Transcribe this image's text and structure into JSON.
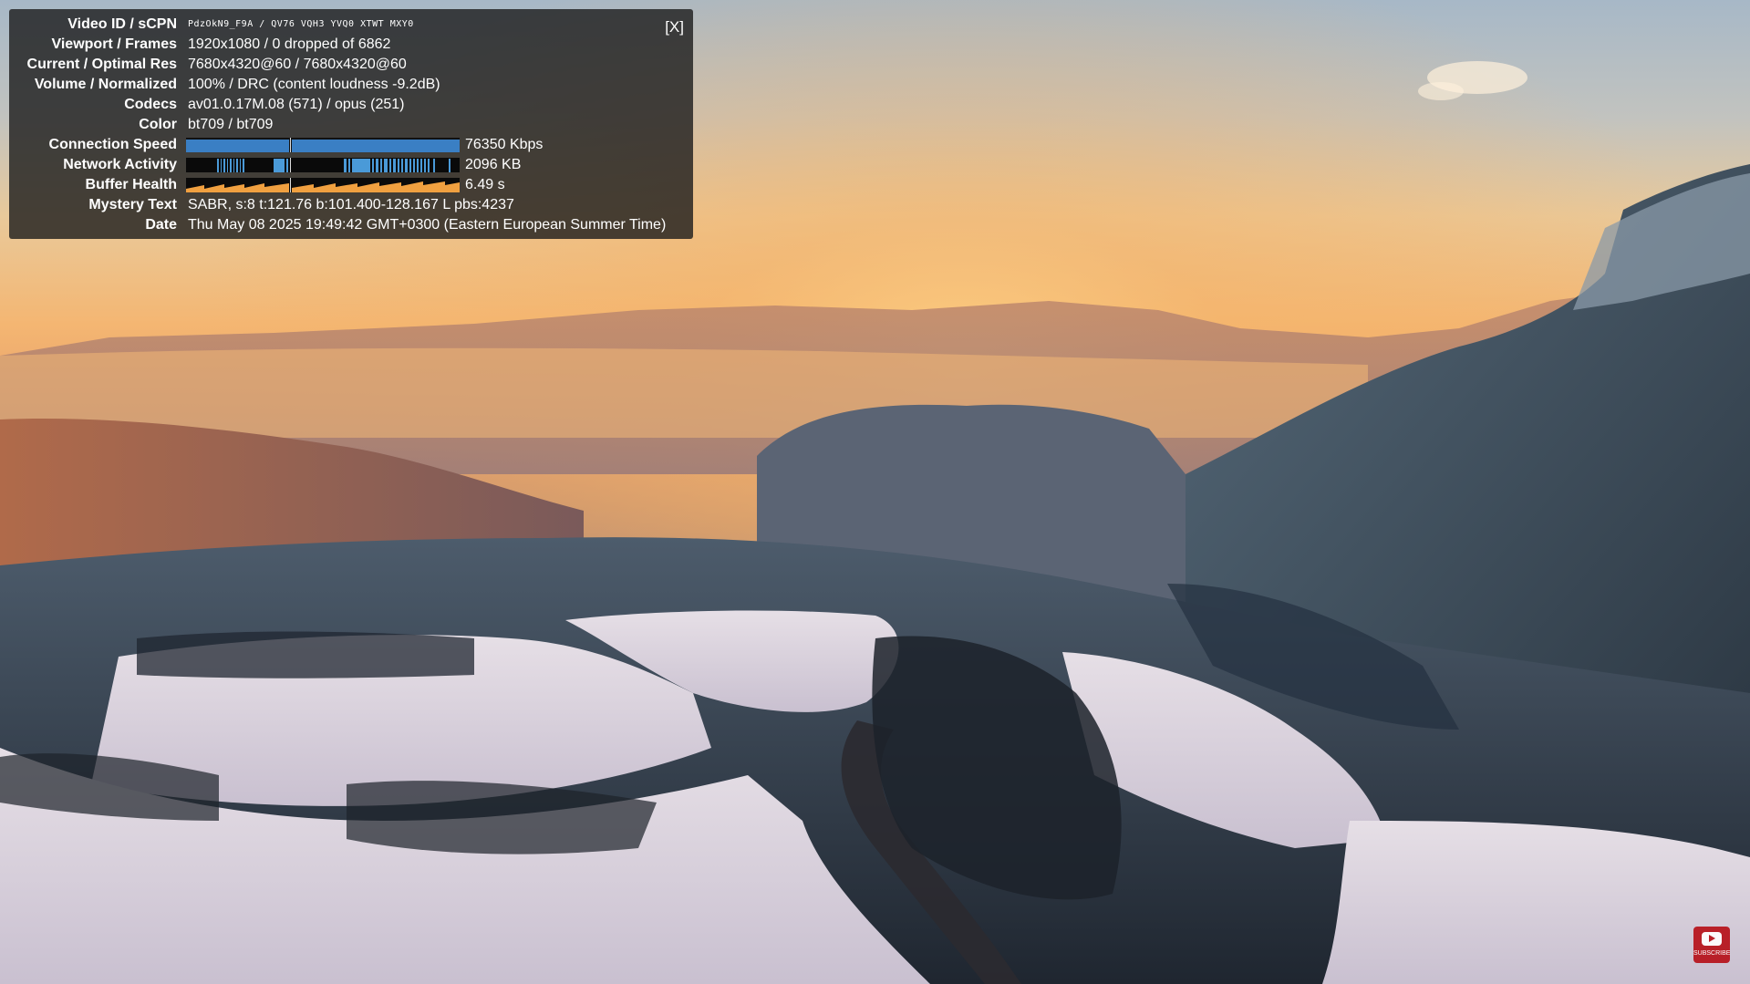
{
  "video": {
    "scene": "aerial-snowy-valley-at-sunset"
  },
  "stats_for_nerds": {
    "close_label": "[X]",
    "rows": [
      {
        "label": "Video ID / sCPN",
        "value": "PdzOkN9_F9A  /  QV76 VQH3 YVQ0 XTWT MXY0"
      },
      {
        "label": "Viewport / Frames",
        "value": "1920x1080 / 0 dropped of 6862"
      },
      {
        "label": "Current / Optimal Res",
        "value": "7680x4320@60 / 7680x4320@60"
      },
      {
        "label": "Volume / Normalized",
        "value": "100% / DRC (content loudness -9.2dB)"
      },
      {
        "label": "Codecs",
        "value": "av01.0.17M.08 (571) / opus (251)"
      },
      {
        "label": "Color",
        "value": "bt709 / bt709"
      },
      {
        "label": "Connection Speed",
        "value": "76350 Kbps"
      },
      {
        "label": "Network Activity",
        "value": "2096 KB"
      },
      {
        "label": "Buffer Health",
        "value": "6.49 s"
      },
      {
        "label": "Mystery Text",
        "value": "SABR, s:8 t:121.76 b:101.400-128.167 L pbs:4237"
      },
      {
        "label": "Date",
        "value": "Thu May 08 2025 19:49:42 GMT+0300 (Eastern European Summer Time)"
      }
    ],
    "graph_colors": {
      "connection": "#3a7fc4",
      "network": "#4a9ad8",
      "buffer": "#f0a040"
    }
  },
  "subscribe_button": {
    "icon": "youtube-play-icon",
    "label": "SUBSCRIBE",
    "color": "#b7121a"
  }
}
